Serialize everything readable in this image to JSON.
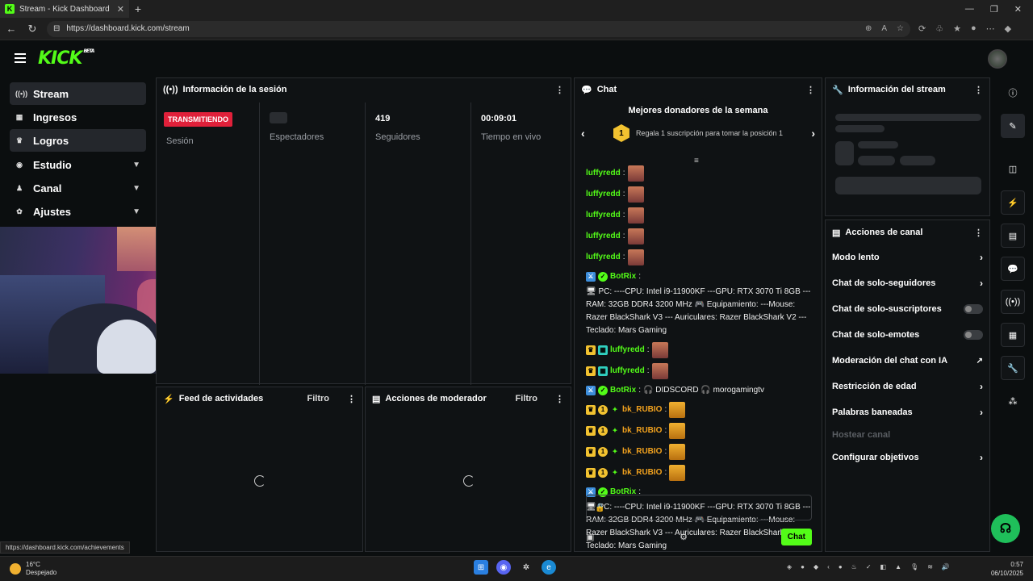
{
  "browser": {
    "tab_title": "Stream - Kick Dashboard",
    "tab_icon": "K",
    "url": "https://dashboard.kick.com/stream",
    "status_url": "https://dashboard.kick.com/achievements"
  },
  "brand": {
    "logo": "KICK",
    "beta": "BETA",
    "accent": "#53fc18"
  },
  "sidebar": {
    "items": [
      {
        "label": "Stream",
        "icon": "broadcast-icon",
        "glyph": "((•))"
      },
      {
        "label": "Ingresos",
        "icon": "chart-icon",
        "glyph": "▦"
      },
      {
        "label": "Logros",
        "icon": "trophy-icon",
        "glyph": "♛"
      },
      {
        "label": "Estudio",
        "icon": "camera-icon",
        "glyph": "◉"
      },
      {
        "label": "Canal",
        "icon": "users-icon",
        "glyph": "♟"
      },
      {
        "label": "Ajustes",
        "icon": "gear-icon",
        "glyph": "✿"
      }
    ]
  },
  "session": {
    "title": "Información de la sesión",
    "live_badge": "TRANSMITIENDO",
    "session_label": "Sesión",
    "viewers_label": "Espectadores",
    "followers_value": "419",
    "followers_label": "Seguidores",
    "time_value": "00:09:01",
    "time_label": "Tiempo en vivo"
  },
  "activity_feed": {
    "title": "Feed de actividades",
    "filter": "Filtro"
  },
  "mod_actions": {
    "title": "Acciones de moderador",
    "filter": "Filtro"
  },
  "chat": {
    "title": "Chat",
    "donors_title": "Mejores donadores de la semana",
    "donor_rank": "1",
    "donor_text": "Regala 1 suscripción para tomar la posición 1",
    "messages": [
      {
        "user": "luffyredd",
        "type": "emote",
        "color": "green",
        "badges": []
      },
      {
        "user": "luffyredd",
        "type": "emote",
        "color": "green",
        "badges": []
      },
      {
        "user": "luffyredd",
        "type": "emote",
        "color": "green",
        "badges": []
      },
      {
        "user": "luffyredd",
        "type": "emote",
        "color": "green",
        "badges": []
      },
      {
        "user": "luffyredd",
        "type": "emote",
        "color": "green",
        "badges": []
      },
      {
        "user": "BotRix",
        "type": "text",
        "color": "green",
        "badges": [
          "blue",
          "grn"
        ],
        "text": "🖥 PC: ----CPU: Intel i9-11900KF ---GPU: RTX 3070 Ti 8GB ---RAM: 32GB DDR4 3200 MHz 🎮 Equipamiento: ---Mouse: Razer BlackShark V3 --- Auriculares: Razer BlackShark V2 ---Teclado: Mars Gaming"
      },
      {
        "user": "luffyredd",
        "type": "emote",
        "color": "green",
        "badges": [
          "gold",
          "cyan"
        ]
      },
      {
        "user": "luffyredd",
        "type": "emote",
        "color": "green",
        "badges": [
          "gold",
          "cyan"
        ]
      },
      {
        "user": "BotRix",
        "type": "text",
        "color": "green",
        "badges": [
          "blue",
          "grn"
        ],
        "text": "🎧 DIDSCORD 🎧 morogamingtv"
      },
      {
        "user": "bk_RUBIO",
        "type": "emote-y",
        "color": "orange",
        "badges": [
          "gold",
          "one",
          "star"
        ]
      },
      {
        "user": "bk_RUBIO",
        "type": "emote-y",
        "color": "orange",
        "badges": [
          "gold",
          "one",
          "star"
        ]
      },
      {
        "user": "bk_RUBIO",
        "type": "emote-y",
        "color": "orange",
        "badges": [
          "gold",
          "one",
          "star"
        ]
      },
      {
        "user": "bk_RUBIO",
        "type": "emote-y",
        "color": "orange",
        "badges": [
          "gold",
          "one",
          "star"
        ]
      },
      {
        "user": "BotRix",
        "type": "text",
        "color": "green",
        "badges": [
          "blue",
          "grn"
        ],
        "text": "🖥 PC: ----CPU: Intel i9-11900KF ---GPU: RTX 3070 Ti 8GB ---RAM: 32GB DDR4 3200 MHz 🎮 Equipamiento: ---Mouse: Razer BlackShark V3 --- Auriculares: Razer BlackShark V2 ---Teclado: Mars Gaming"
      }
    ],
    "send_label": "Chat"
  },
  "stream_info": {
    "title": "Información del stream"
  },
  "channel_actions": {
    "title": "Acciones de canal",
    "items": [
      {
        "label": "Modo lento",
        "control": "chevron"
      },
      {
        "label": "Chat de solo-seguidores",
        "control": "chevron"
      },
      {
        "label": "Chat de solo-suscriptores",
        "control": "toggle"
      },
      {
        "label": "Chat de solo-emotes",
        "control": "toggle"
      },
      {
        "label": "Moderación del chat con IA",
        "control": "external"
      },
      {
        "label": "Restricción de edad",
        "control": "chevron"
      },
      {
        "label": "Palabras baneadas",
        "control": "chevron"
      },
      {
        "label": "Hostear canal",
        "control": "none"
      },
      {
        "label": "Configurar objetivos",
        "control": "chevron"
      }
    ]
  },
  "taskbar": {
    "temp": "16°C",
    "weather": "Despejado",
    "time": "0:57",
    "date": "06/10/2025"
  }
}
